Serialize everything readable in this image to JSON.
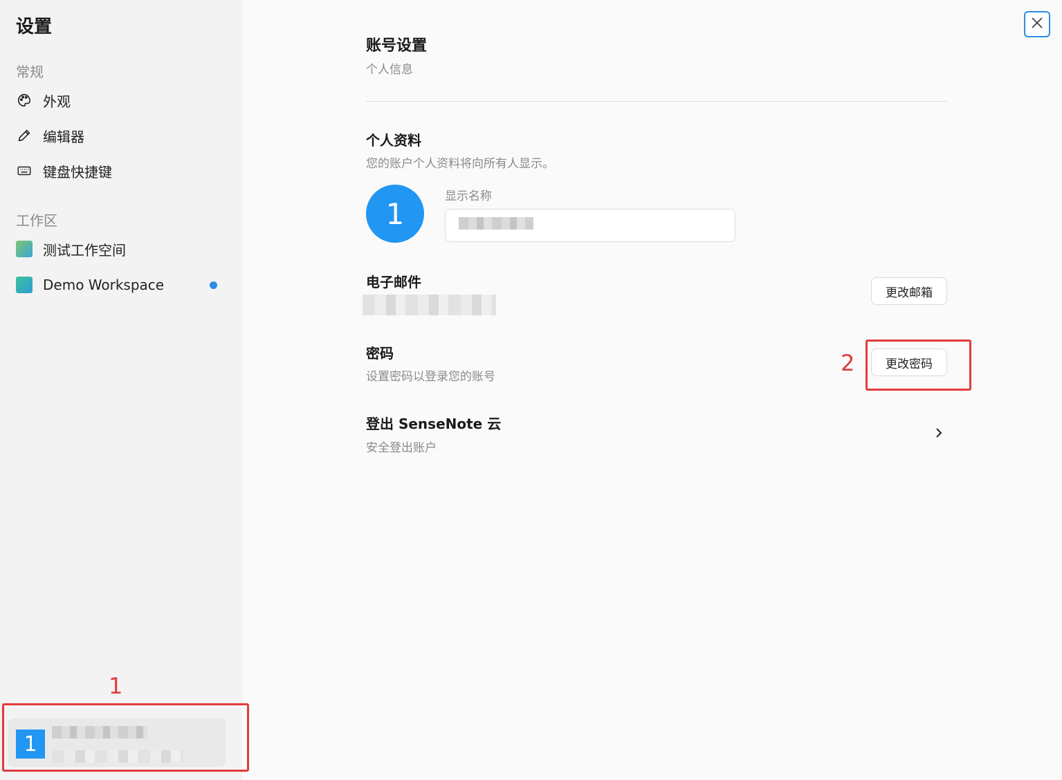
{
  "sidebar": {
    "title": "设置",
    "general_section": "常规",
    "general_items": [
      {
        "label": "外观",
        "icon": "palette-icon"
      },
      {
        "label": "编辑器",
        "icon": "pencil-icon"
      },
      {
        "label": "键盘快捷键",
        "icon": "keyboard-icon"
      }
    ],
    "workspace_section": "工作区",
    "workspaces": [
      {
        "label": "测试工作空间"
      },
      {
        "label": "Demo Workspace",
        "active_dot_color": "#2b8de8"
      }
    ],
    "user_card": {
      "avatar_text": "1"
    }
  },
  "annotations": [
    {
      "number": "1",
      "color": "#e23b3b"
    },
    {
      "number": "2",
      "color": "#e23b3b"
    }
  ],
  "main": {
    "title": "账号设置",
    "subtitle": "个人信息",
    "profile": {
      "heading": "个人资料",
      "description": "您的账户个人资料将向所有人显示。",
      "avatar_text": "1",
      "display_name_label": "显示名称"
    },
    "email": {
      "heading": "电子邮件",
      "button": "更改邮箱"
    },
    "password": {
      "heading": "密码",
      "description": "设置密码以登录您的账号",
      "button": "更改密码"
    },
    "logout": {
      "heading": "登出 SenseNote 云",
      "description": "安全登出账户"
    }
  },
  "colors": {
    "accent": "#2196f3",
    "annotation": "#e23b3b",
    "focus": "#2b8de8"
  }
}
